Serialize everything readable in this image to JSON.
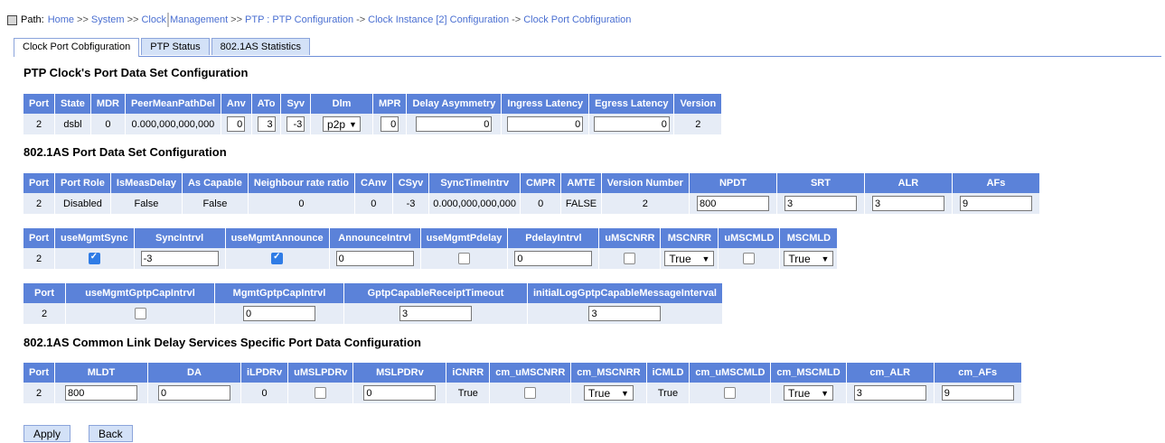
{
  "path": {
    "label": "Path:",
    "crumbs": [
      "Home",
      "System",
      "Clock",
      "Management",
      "PTP : PTP Configuration",
      "Clock Instance [2] Configuration",
      "Clock Port Cobfiguration"
    ],
    "seps": [
      ">>",
      ">>",
      ">>",
      "->",
      "->"
    ]
  },
  "tabs": [
    "Clock Port Cobfiguration",
    "PTP Status",
    "802.1AS Statistics"
  ],
  "sections": {
    "s1": "PTP Clock's Port Data Set Configuration",
    "s2": "802.1AS Port Data Set Configuration",
    "s3": "802.1AS Common Link Delay Services Specific Port Data Configuration"
  },
  "t1": {
    "headers": [
      "Port",
      "State",
      "MDR",
      "PeerMeanPathDel",
      "Anv",
      "ATo",
      "Syv",
      "Dlm",
      "MPR",
      "Delay Asymmetry",
      "Ingress Latency",
      "Egress Latency",
      "Version"
    ],
    "row": {
      "port": "2",
      "state": "dsbl",
      "mdr": "0",
      "peer": "0.000,000,000,000",
      "anv": "0",
      "ato": "3",
      "syv": "-3",
      "dlm": "p2p",
      "mpr": "0",
      "delay_asym": "0",
      "ingress": "0",
      "egress": "0",
      "version": "2"
    }
  },
  "t2": {
    "headers": [
      "Port",
      "Port Role",
      "IsMeasDelay",
      "As Capable",
      "Neighbour rate ratio",
      "CAnv",
      "CSyv",
      "SyncTimeIntrv",
      "CMPR",
      "AMTE",
      "Version Number",
      "NPDT",
      "SRT",
      "ALR",
      "AFs"
    ],
    "row": {
      "port": "2",
      "role": "Disabled",
      "ismeas": "False",
      "ascap": "False",
      "nrr": "0",
      "canv": "0",
      "csyv": "-3",
      "sti": "0.000,000,000,000",
      "cmpr": "0",
      "amte": "FALSE",
      "vn": "2",
      "npdt": "800",
      "srt": "3",
      "alr": "3",
      "afs": "9"
    }
  },
  "t3": {
    "headers": [
      "Port",
      "useMgmtSync",
      "SyncIntrvl",
      "useMgmtAnnounce",
      "AnnounceIntrvl",
      "useMgmtPdelay",
      "PdelayIntrvl",
      "uMSCNRR",
      "MSCNRR",
      "uMSCMLD",
      "MSCMLD"
    ],
    "row": {
      "port": "2",
      "sync_intrvl": "-3",
      "announce_intrvl": "0",
      "pdelay_intrvl": "0",
      "mscnrr": "True",
      "mscmld": "True"
    }
  },
  "t4": {
    "headers": [
      "Port",
      "useMgmtGptpCapIntrvl",
      "MgmtGptpCapIntrvl",
      "GptpCapableReceiptTimeout",
      "initialLogGptpCapableMessageInterval"
    ],
    "row": {
      "port": "2",
      "mgmt_cap": "0",
      "receipt": "3",
      "initial": "3"
    }
  },
  "t5": {
    "headers": [
      "Port",
      "MLDT",
      "DA",
      "iLPDRv",
      "uMSLPDRv",
      "MSLPDRv",
      "iCNRR",
      "cm_uMSCNRR",
      "cm_MSCNRR",
      "iCMLD",
      "cm_uMSCMLD",
      "cm_MSCMLD",
      "cm_ALR",
      "cm_AFs"
    ],
    "row": {
      "port": "2",
      "mldt": "800",
      "da": "0",
      "ilpdrv": "0",
      "mslpdrv": "0",
      "icnrr": "True",
      "cm_mscnrr": "True",
      "icmld": "True",
      "cm_mscmld": "True",
      "cm_alr": "3",
      "cm_afs": "9"
    }
  },
  "buttons": {
    "apply": "Apply",
    "back": "Back"
  }
}
